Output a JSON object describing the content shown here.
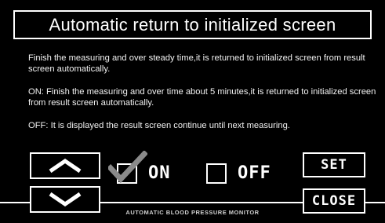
{
  "title": "Automatic return to initialized screen",
  "description": {
    "para1": "Finish the measuring and over steady time,it is returned to initialized screen from result screen automatically.",
    "para2": "ON: Finish the measuring and over time about 5 minutes,it is returned to initialized screen from result screen automatically.",
    "para3": "OFF: It is displayed the result screen continue until next measuring."
  },
  "controls": {
    "up_icon": "up-chevron-icon",
    "down_icon": "down-chevron-icon",
    "on_label": "ON",
    "off_label": "OFF",
    "on_checked": true,
    "off_checked": false,
    "set_label": "SET",
    "close_label": "CLOSE"
  },
  "footer": "AUTOMATIC BLOOD PRESSURE MONITOR",
  "colors": {
    "background": "#000000",
    "foreground": "#ffffff",
    "checkmark": "#8a8a8a"
  }
}
